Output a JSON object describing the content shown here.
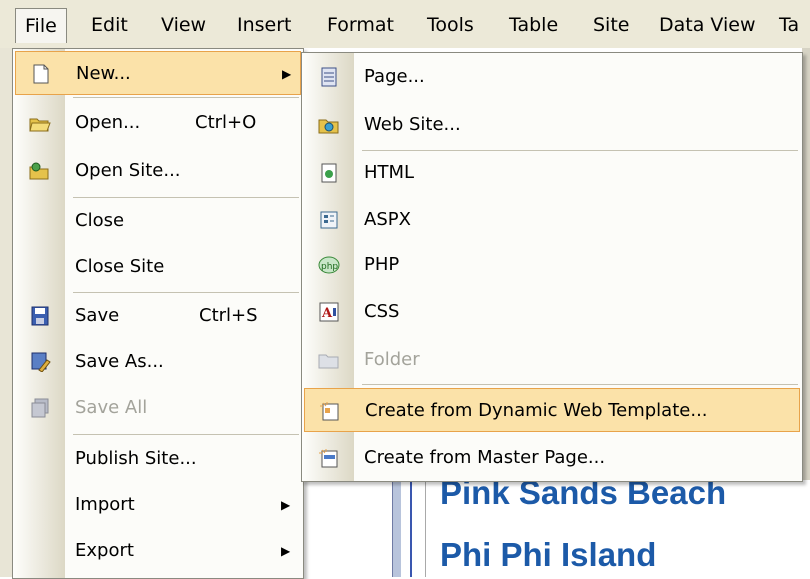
{
  "menubar": {
    "items": [
      "File",
      "Edit",
      "View",
      "Insert",
      "Format",
      "Tools",
      "Table",
      "Site",
      "Data View",
      "Ta"
    ]
  },
  "file_menu": {
    "new": "New...",
    "open": "Open...",
    "open_shortcut": "Ctrl+O",
    "open_site": "Open Site...",
    "close": "Close",
    "close_site": "Close Site",
    "save": "Save",
    "save_shortcut": "Ctrl+S",
    "save_as": "Save As...",
    "save_all": "Save All",
    "publish_site": "Publish Site...",
    "import": "Import",
    "export": "Export"
  },
  "new_submenu": {
    "page": "Page...",
    "web_site": "Web Site...",
    "html": "HTML",
    "aspx": "ASPX",
    "php": "PHP",
    "css": "CSS",
    "folder": "Folder",
    "dwt": "Create from Dynamic Web Template...",
    "master": "Create from Master Page..."
  },
  "document": {
    "heading1": "Pink Sands Beach",
    "heading2": "Phi Phi Island"
  },
  "colors": {
    "menubar_bg": "#ece9d8",
    "hover_bg": "#fbe2a9",
    "hover_border": "#e8a34a",
    "heading": "#1c5aa8"
  }
}
